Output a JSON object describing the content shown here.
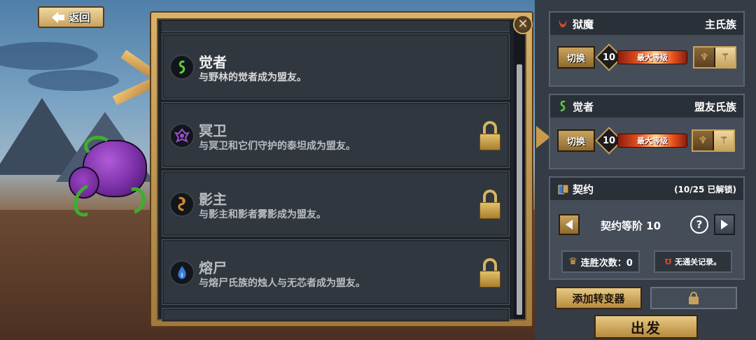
{
  "back_button": {
    "label": "返回"
  },
  "modal": {
    "close_label": "✕",
    "clans": [
      {
        "name": "觉者",
        "description": "与野林的觉者成为盟友。",
        "icon": "awakened-swirl-icon",
        "icon_color": "#5ccf3a",
        "locked": false
      },
      {
        "name": "冥卫",
        "description": "与冥卫和它们守护的泰坦成为盟友。",
        "icon": "dreadguard-sigil-icon",
        "icon_color": "#9b4fd1",
        "locked": true
      },
      {
        "name": "影主",
        "description": "与影主和影者雾影成为盟友。",
        "icon": "shadowlord-hook-icon",
        "icon_color": "#d28a2e",
        "locked": true
      },
      {
        "name": "熔尸",
        "description": "与熔尸氏族的烛人与无芯者成为盟友。",
        "icon": "candle-flame-icon",
        "icon_color": "#3a7bd5",
        "locked": true
      }
    ]
  },
  "sidebar": {
    "primary_clan": {
      "name": "狱魔",
      "role": "主氏族",
      "icon": "demon-horns-icon",
      "icon_color": "#e04a2a",
      "switch_label": "切换",
      "level": "10",
      "level_label": "最大等级"
    },
    "allied_clan": {
      "name": "觉者",
      "role": "盟友氏族",
      "icon": "awakened-swirl-icon",
      "icon_color": "#5ccf3a",
      "switch_label": "切换",
      "level": "10",
      "level_label": "最大等级"
    },
    "covenant": {
      "title": "契约",
      "unlocked": "(10/25 已解锁)",
      "rank_label": "契约等阶 10",
      "help": "?",
      "win_streak": "连胜次数：0",
      "no_record": "无通关记录。"
    },
    "add_mutator_label": "添加转变器",
    "depart_label": "出发"
  }
}
